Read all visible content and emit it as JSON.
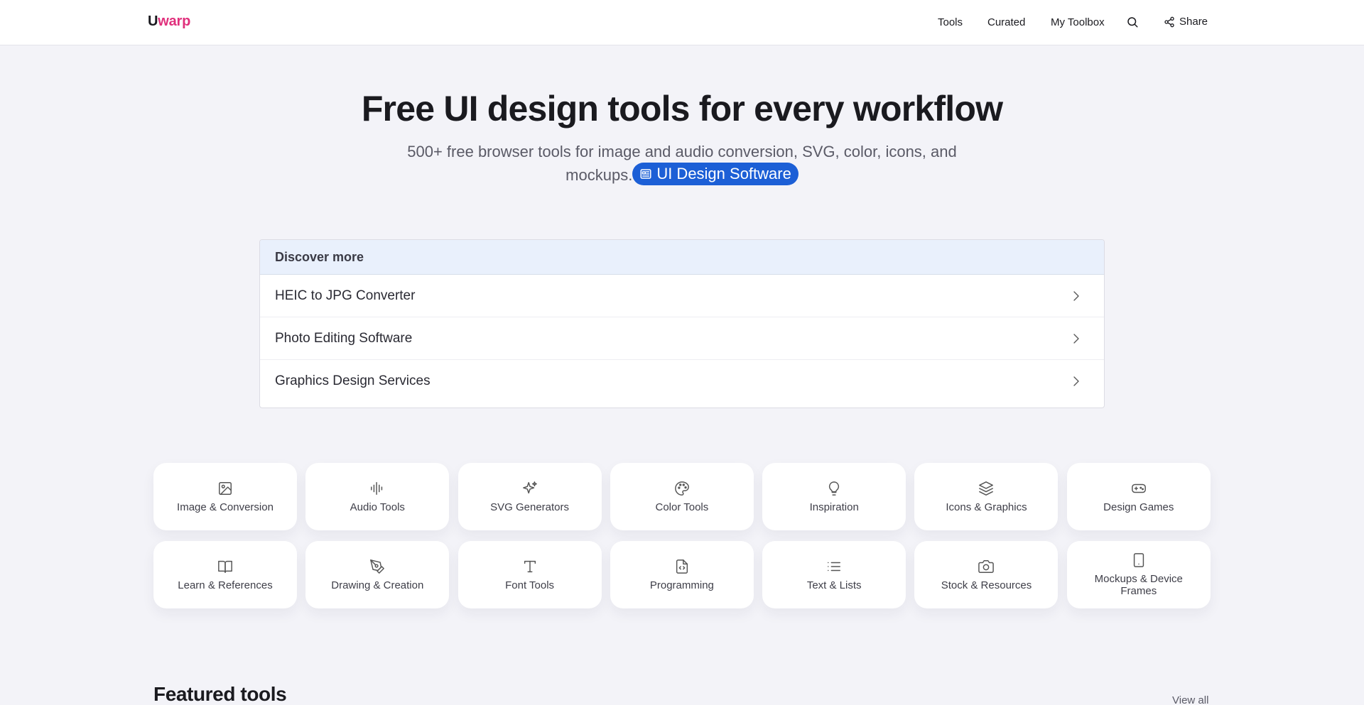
{
  "header": {
    "logo_first": "U",
    "logo_rest": "warp",
    "nav": [
      "Tools",
      "Curated",
      "My Toolbox"
    ],
    "share_label": "Share"
  },
  "hero": {
    "title": "Free UI design tools for every workflow",
    "subtitle": "500+ free browser tools for image and audio conversion, SVG, color, icons, and mockups.",
    "pill_label": "UI Design Software"
  },
  "discover": {
    "heading": "Discover more",
    "items": [
      "HEIC to JPG Converter",
      "Photo Editing Software",
      "Graphics Design Services"
    ]
  },
  "categories": [
    {
      "label": "Image & Conversion",
      "icon": "image-icon"
    },
    {
      "label": "Audio Tools",
      "icon": "audio-waveform-icon"
    },
    {
      "label": "SVG Generators",
      "icon": "sparkles-icon"
    },
    {
      "label": "Color Tools",
      "icon": "palette-icon"
    },
    {
      "label": "Inspiration",
      "icon": "lightbulb-icon"
    },
    {
      "label": "Icons & Graphics",
      "icon": "layers-icon"
    },
    {
      "label": "Design Games",
      "icon": "gamepad-icon"
    },
    {
      "label": "Learn & References",
      "icon": "book-icon"
    },
    {
      "label": "Drawing & Creation",
      "icon": "pen-tool-icon"
    },
    {
      "label": "Font Tools",
      "icon": "type-icon"
    },
    {
      "label": "Programming",
      "icon": "file-code-icon"
    },
    {
      "label": "Text & Lists",
      "icon": "list-icon"
    },
    {
      "label": "Stock & Resources",
      "icon": "camera-icon"
    },
    {
      "label": "Mockups & Device Frames",
      "icon": "smartphone-icon"
    }
  ],
  "featured": {
    "title": "Featured tools",
    "view_all": "View all"
  },
  "colors": {
    "brand_pink": "#e0307c",
    "pill_blue": "#1c5fd6",
    "discover_header_bg": "#e9f0fc"
  }
}
